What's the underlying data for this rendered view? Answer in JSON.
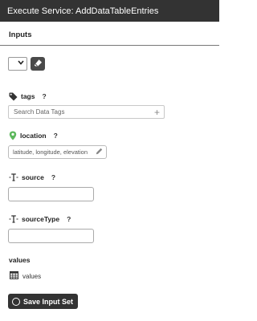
{
  "window": {
    "title": "Execute Service: AddDataTableEntries"
  },
  "inputs_section": {
    "title": "Inputs"
  },
  "toolbar": {
    "selected_value": ""
  },
  "fields": {
    "tags": {
      "label": "tags",
      "help": "?",
      "placeholder": "Search Data Tags",
      "icon": "tag-icon"
    },
    "location": {
      "label": "location",
      "help": "?",
      "placeholder": "latitude, longitude, elevation",
      "icon": "map-pin-icon"
    },
    "source": {
      "label": "source",
      "help": "?",
      "value": "",
      "icon": "string-type-icon"
    },
    "sourceType": {
      "label": "sourceType",
      "help": "?",
      "value": "",
      "icon": "string-type-icon"
    }
  },
  "values": {
    "heading": "values",
    "item_label": "values",
    "icon": "table-icon"
  },
  "save_button": {
    "label": "Save Input Set"
  },
  "colors": {
    "titlebar": "#333333",
    "button": "#333333",
    "location_pin": "#5cb85c"
  }
}
